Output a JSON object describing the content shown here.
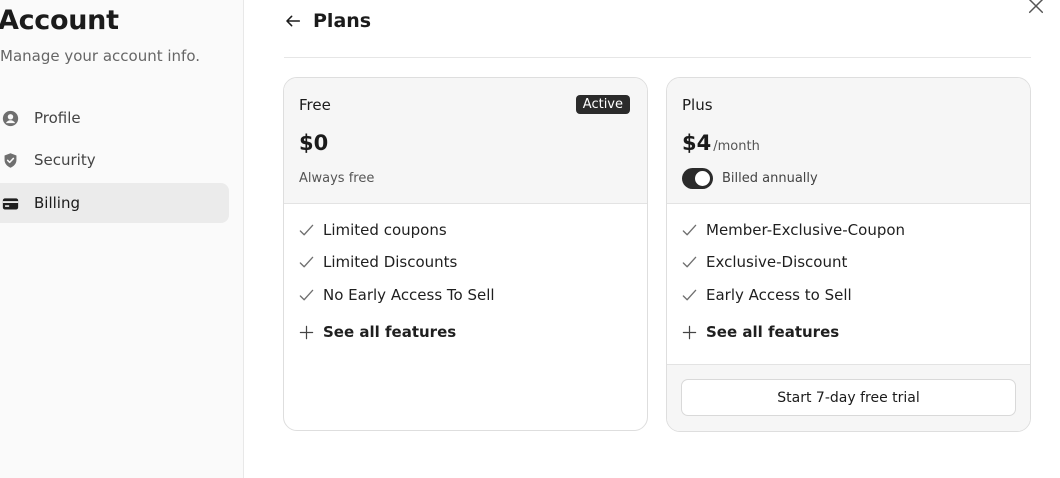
{
  "sidebar": {
    "title": "Account",
    "subtitle": "Manage your account info.",
    "items": [
      {
        "label": "Profile",
        "icon": "user-circle-icon"
      },
      {
        "label": "Security",
        "icon": "shield-check-icon"
      },
      {
        "label": "Billing",
        "icon": "credit-card-icon",
        "active": true
      }
    ]
  },
  "header": {
    "back_icon": "arrow-left-icon",
    "title": "Plans",
    "close_icon": "close-icon"
  },
  "plans": [
    {
      "name": "Free",
      "badge": "Active",
      "price": "$0",
      "note": "Always free",
      "features": [
        "Limited coupons",
        "Limited Discounts",
        "No Early Access To Sell"
      ],
      "see_all": "See all features"
    },
    {
      "name": "Plus",
      "price": "$4",
      "period": "/month",
      "toggle_label": "Billed annually",
      "toggle_on": true,
      "features": [
        "Member-Exclusive-Coupon",
        "Exclusive-Discount",
        "Early Access to Sell"
      ],
      "see_all": "See all features",
      "cta": "Start 7-day free trial"
    }
  ],
  "colors": {
    "accent": "#2b2b2b",
    "sidebar_bg": "#fafafa",
    "card_header_bg": "#f6f6f6",
    "border": "#dedede"
  }
}
